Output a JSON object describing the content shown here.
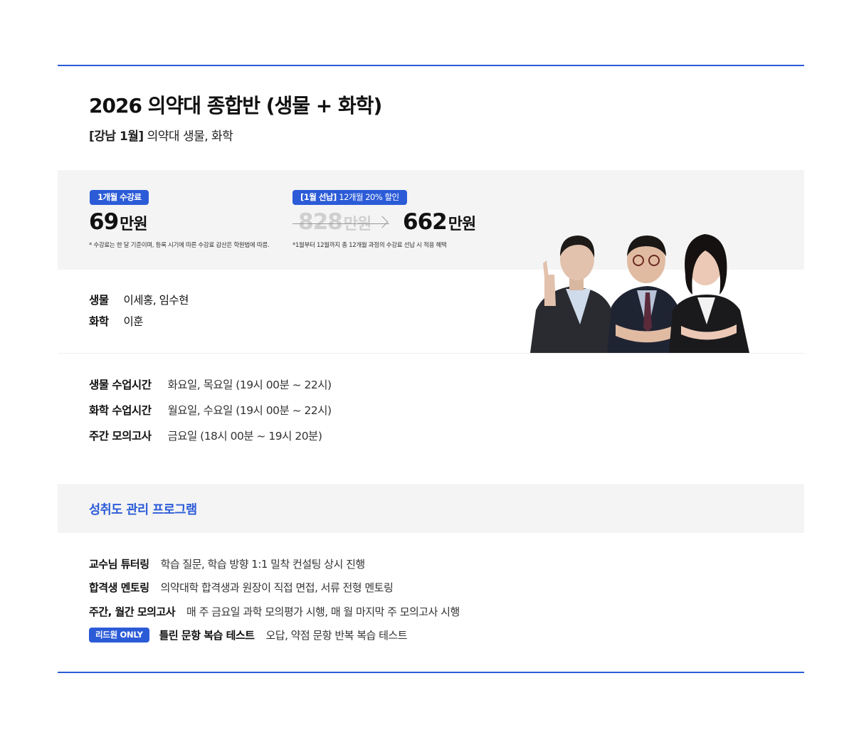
{
  "course": {
    "title": "2026 의약대 종합반 (생물 + 화학)",
    "tag": "[강남 1월]",
    "subtitle": "의약대 생물, 화학"
  },
  "pricing": {
    "monthly": {
      "badge": "1개월 수강료",
      "amount": "69",
      "unit": "만원",
      "note": "* 수강료는 한 달 기준이며, 등록 시기에 따른 수강료 감산은 학원법에 따름."
    },
    "prepay": {
      "badge_bold": "[1월 선납]",
      "badge_text": "12개월 20% 할인",
      "original_amount": "828",
      "original_unit": "만원",
      "discount_amount": "662",
      "discount_unit": "만원",
      "note": "*1월부터 12월까지 총 12개월 과정의 수강료 선납 시 적용 혜택"
    }
  },
  "teachers": [
    {
      "subject": "생물",
      "names": "이세홍, 임수현"
    },
    {
      "subject": "화학",
      "names": "이훈"
    }
  ],
  "schedule": [
    {
      "label": "생물 수업시간",
      "value": "화요일, 목요일 (19시 00분 ~ 22시)"
    },
    {
      "label": "화학 수업시간",
      "value": "월요일, 수요일 (19시 00분 ~ 22시)"
    },
    {
      "label": "주간 모의고사",
      "value": "금요일 (18시 00분 ~ 19시 20분)"
    }
  ],
  "program": {
    "title": "성취도 관리 프로그램",
    "items": [
      {
        "badge": "",
        "label": "교수님 튜터링",
        "desc": "학습 질문, 학습 방향 1:1 밀착 컨설팅 상시 진행"
      },
      {
        "badge": "",
        "label": "합격생 멘토링",
        "desc": "의약대학 합격생과 원장이 직접 면접, 서류 전형 멘토링"
      },
      {
        "badge": "",
        "label": "주간, 월간 모의고사",
        "desc": "매 주 금요일 과학 모의평가 시행, 매 월 마지막 주 모의고사 시행"
      },
      {
        "badge": "리드원 ONLY",
        "label": "틀린 문항 복습 테스트",
        "desc": "오답, 약점 문항 반복 복습 테스트"
      }
    ]
  },
  "colors": {
    "accent": "#2b5bd7",
    "panel": "#f4f4f4"
  }
}
